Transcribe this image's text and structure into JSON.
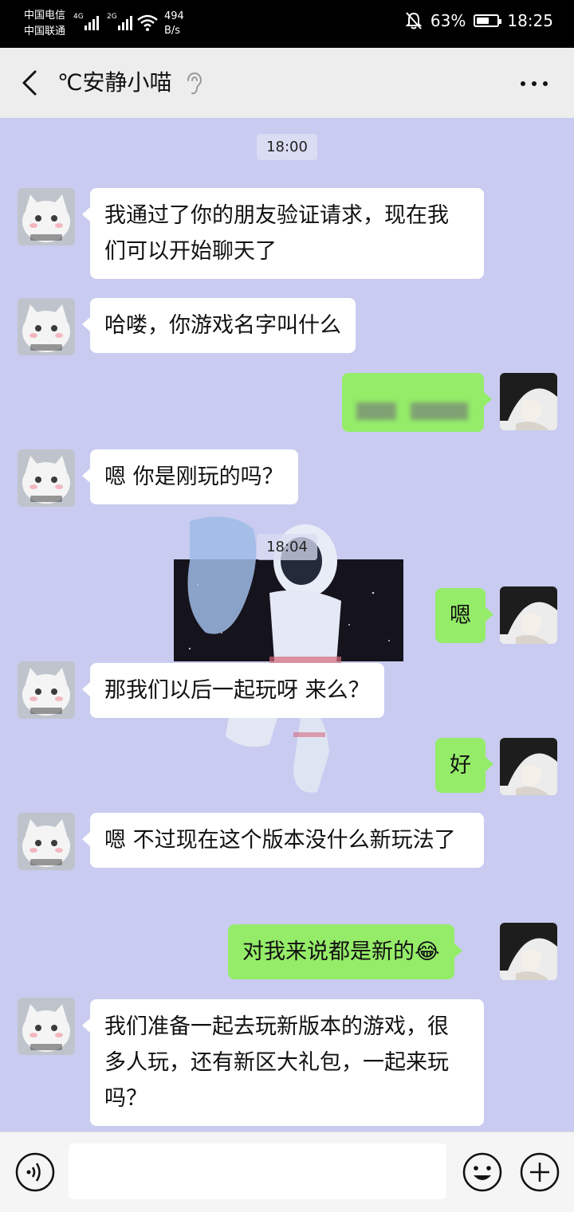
{
  "status_bar": {
    "carrier_1": "中国电信",
    "carrier_2": "中国联通",
    "net_1": "4G",
    "net_2": "2G",
    "speed_value": "494",
    "speed_unit": "B/s",
    "battery": "63%",
    "battery_level": 0.63,
    "time": "18:25"
  },
  "header": {
    "title": "℃安静小喵"
  },
  "chat": {
    "timestamps": [
      "18:00",
      "18:04"
    ],
    "messages": [
      {
        "from": "other",
        "text": "我通过了你的朋友验证请求，现在我们可以开始聊天了"
      },
      {
        "from": "other",
        "text": "哈喽，你游戏名字叫什么"
      },
      {
        "from": "me",
        "text": ""
      },
      {
        "from": "other",
        "text": "嗯 你是刚玩的吗？"
      },
      {
        "from": "me",
        "text": "嗯"
      },
      {
        "from": "other",
        "text": "那我们以后一起玩呀 来么？"
      },
      {
        "from": "me",
        "text": "好"
      },
      {
        "from": "other",
        "text": "嗯 不过现在这个版本没什么新玩法了"
      },
      {
        "from": "me",
        "text": "对我来说都是新的😂"
      },
      {
        "from": "other",
        "text": "我们准备一起去玩新版本的游戏，很多人玩，还有新区大礼包，一起来玩吗？"
      }
    ]
  },
  "input": {
    "value": ""
  },
  "icons": {
    "back": "chevron-left-icon",
    "ear": "ear-icon",
    "more": "more-icon",
    "voice": "voice-icon",
    "emoji": "emoji-icon",
    "plus": "plus-icon"
  },
  "colors": {
    "incoming_bubble": "#ffffff",
    "outgoing_bubble": "#95ec69",
    "chat_background": "#c9cbf0",
    "header_background": "#ededed"
  }
}
